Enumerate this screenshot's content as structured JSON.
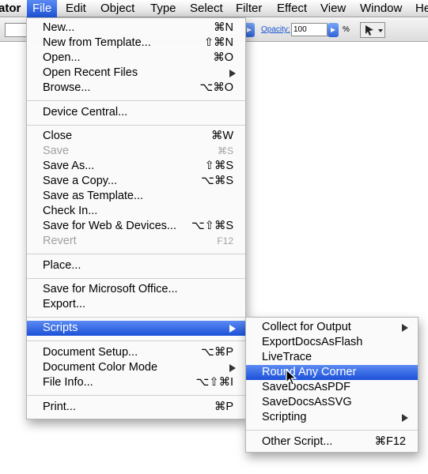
{
  "menubar": {
    "items": [
      "ator",
      "File",
      "Edit",
      "Object",
      "Type",
      "Select",
      "Filter",
      "Effect",
      "View",
      "Window",
      "He"
    ]
  },
  "controlbar": {
    "opacity_label": "Opacity:",
    "opacity_value": "100",
    "percent": "%"
  },
  "file_menu": {
    "items": [
      {
        "label": "New...",
        "shortcut": "⌘N"
      },
      {
        "label": "New from Template...",
        "shortcut": "⇧⌘N"
      },
      {
        "label": "Open...",
        "shortcut": "⌘O"
      },
      {
        "label": "Open Recent Files",
        "submenu": true
      },
      {
        "label": "Browse...",
        "shortcut": "⌥⌘O"
      },
      {
        "label": "Device Central...",
        "shortcut": ""
      },
      {
        "label": "Close",
        "shortcut": "⌘W"
      },
      {
        "label": "Save",
        "shortcut": "⌘S",
        "disabled": true
      },
      {
        "label": "Save As...",
        "shortcut": "⇧⌘S"
      },
      {
        "label": "Save a Copy...",
        "shortcut": "⌥⌘S"
      },
      {
        "label": "Save as Template...",
        "shortcut": ""
      },
      {
        "label": "Check In...",
        "shortcut": ""
      },
      {
        "label": "Save for Web & Devices...",
        "shortcut": "⌥⇧⌘S"
      },
      {
        "label": "Revert",
        "shortcut": "F12",
        "disabled": true
      },
      {
        "label": "Place...",
        "shortcut": ""
      },
      {
        "label": "Save for Microsoft Office...",
        "shortcut": ""
      },
      {
        "label": "Export...",
        "shortcut": ""
      },
      {
        "label": "Scripts",
        "submenu": true,
        "highlighted": true
      },
      {
        "label": "Document Setup...",
        "shortcut": "⌥⌘P"
      },
      {
        "label": "Document Color Mode",
        "submenu": true
      },
      {
        "label": "File Info...",
        "shortcut": "⌥⇧⌘I"
      },
      {
        "label": "Print...",
        "shortcut": "⌘P"
      }
    ]
  },
  "scripts_menu": {
    "items": [
      {
        "label": "Collect for Output",
        "submenu": true
      },
      {
        "label": "ExportDocsAsFlash",
        "shortcut": ""
      },
      {
        "label": "LiveTrace",
        "shortcut": ""
      },
      {
        "label": "Round Any Corner",
        "highlighted": true
      },
      {
        "label": "SaveDocsAsPDF",
        "shortcut": ""
      },
      {
        "label": "SaveDocsAsSVG",
        "shortcut": ""
      },
      {
        "label": "Scripting",
        "submenu": true
      },
      {
        "label": "Other Script...",
        "shortcut": "⌘F12"
      }
    ]
  },
  "colors": {
    "highlight": "#1b50d8",
    "disabled_text": "#a0a0a0"
  }
}
